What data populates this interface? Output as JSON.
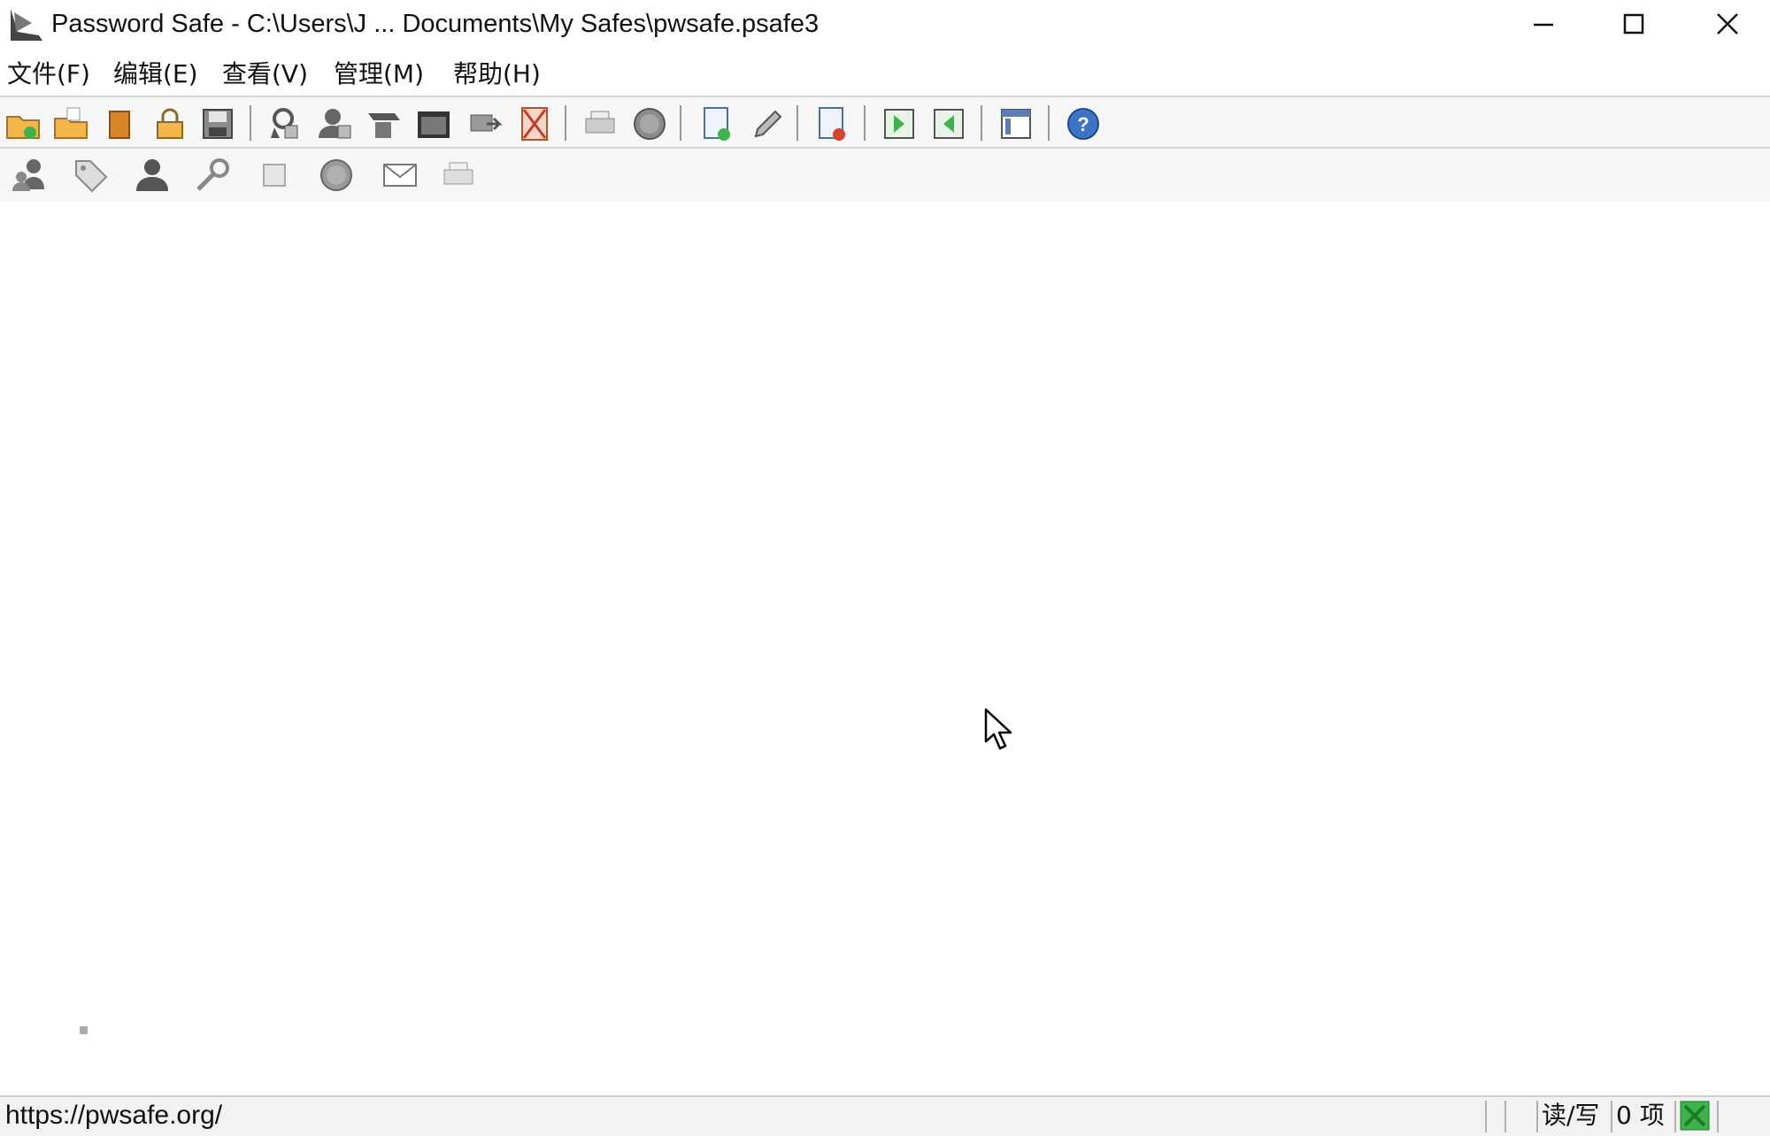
{
  "window": {
    "title": "Password Safe - C:\\Users\\J ... Documents\\My Safes\\pwsafe.psafe3",
    "controls": [
      "minimize-icon",
      "maximize-icon",
      "close-icon"
    ]
  },
  "menu": {
    "items": [
      "文件(F)",
      "编辑(E)",
      "查看(V)",
      "管理(M)",
      "帮助(H)"
    ]
  },
  "toolbar": {
    "row1_icons": [
      "new-database-icon",
      "open-database-icon",
      "close-database-icon",
      "lock-database-icon",
      "save-icon",
      "copy-password-icon",
      "copy-username-icon",
      "copy-notes-icon",
      "clear-clipboard-icon",
      "autotype-icon",
      "browse-url-icon",
      "print-icon",
      "spell-check-icon",
      "add-entry-icon",
      "edit-entry-icon",
      "delete-entry-icon",
      "expand-all-icon",
      "collapse-all-icon",
      "options-icon",
      "help-icon"
    ],
    "row2_icons": [
      "copy-entry-icon",
      "tag-icon",
      "user-icon",
      "key-icon",
      "note-icon",
      "globe-icon",
      "email-icon",
      "print-entry-icon"
    ]
  },
  "status": {
    "url": "https://pwsafe.org/",
    "mode": "读/写",
    "count": "0 项"
  },
  "colors": {
    "accent_green": "#3cb44a",
    "folder_yellow": "#f2b64a",
    "help_blue": "#3b74c4"
  }
}
